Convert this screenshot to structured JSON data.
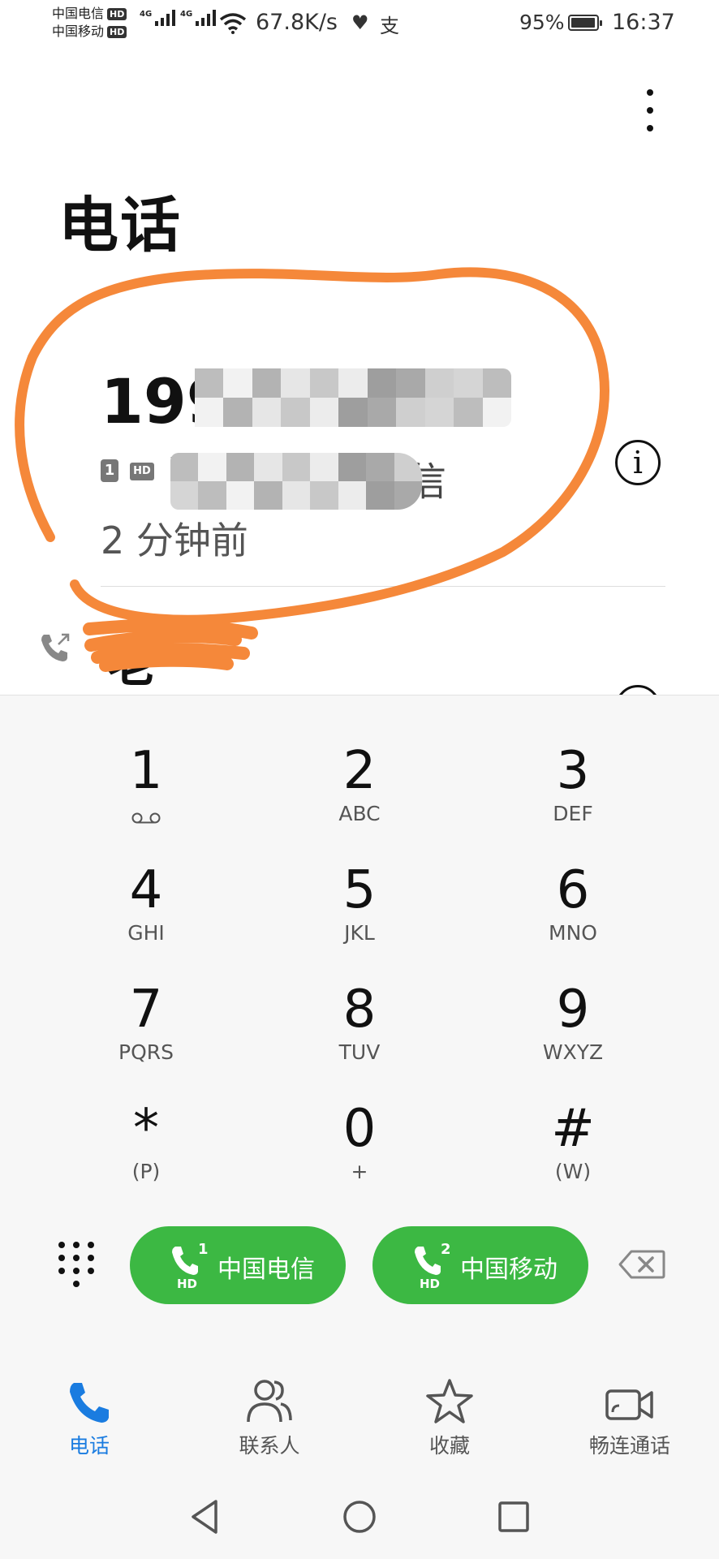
{
  "status_bar": {
    "carrier_1": "中国电信",
    "carrier_2": "中国移动",
    "hd_label": "HD",
    "network_type": "4G",
    "net_speed": "67.8K/s",
    "alipay_glyph": "支",
    "battery_percent": "95%",
    "battery_level": 0.95,
    "time": "16:37"
  },
  "header": {
    "title": "电话",
    "menu_icon": "more-vertical-icon"
  },
  "recent_calls": [
    {
      "number_visible": "199",
      "sim_slot": "1",
      "hd_label": "HD",
      "location_visible_start": "Г",
      "location_visible_end": "信",
      "time": "2 分钟前",
      "info_icon": "info-icon",
      "info_glyph": "i",
      "redacted": true
    },
    {
      "name_visible": "老",
      "call_type_icon": "outgoing-call-icon"
    }
  ],
  "dialpad": {
    "keys": [
      {
        "digit": "1",
        "letters": ""
      },
      {
        "digit": "2",
        "letters": "ABC"
      },
      {
        "digit": "3",
        "letters": "DEF"
      },
      {
        "digit": "4",
        "letters": "GHI"
      },
      {
        "digit": "5",
        "letters": "JKL"
      },
      {
        "digit": "6",
        "letters": "MNO"
      },
      {
        "digit": "7",
        "letters": "PQRS"
      },
      {
        "digit": "8",
        "letters": "TUV"
      },
      {
        "digit": "9",
        "letters": "WXYZ"
      },
      {
        "digit": "*",
        "letters": "(P)"
      },
      {
        "digit": "0",
        "letters": "+"
      },
      {
        "digit": "#",
        "letters": "(W)"
      }
    ],
    "voicemail_icon": "voicemail-icon"
  },
  "call_buttons": [
    {
      "sim": "1",
      "hd": "HD",
      "label": "中国电信"
    },
    {
      "sim": "2",
      "hd": "HD",
      "label": "中国移动"
    }
  ],
  "bottom_nav": [
    {
      "label": "电话",
      "icon": "phone-icon",
      "active": true
    },
    {
      "label": "联系人",
      "icon": "contacts-icon",
      "active": false
    },
    {
      "label": "收藏",
      "icon": "star-icon",
      "active": false
    },
    {
      "label": "畅连通话",
      "icon": "video-call-icon",
      "active": false
    }
  ],
  "colors": {
    "accent_blue": "#1a7ce0",
    "call_green": "#3cb843",
    "annotation_orange": "#f5883a"
  }
}
